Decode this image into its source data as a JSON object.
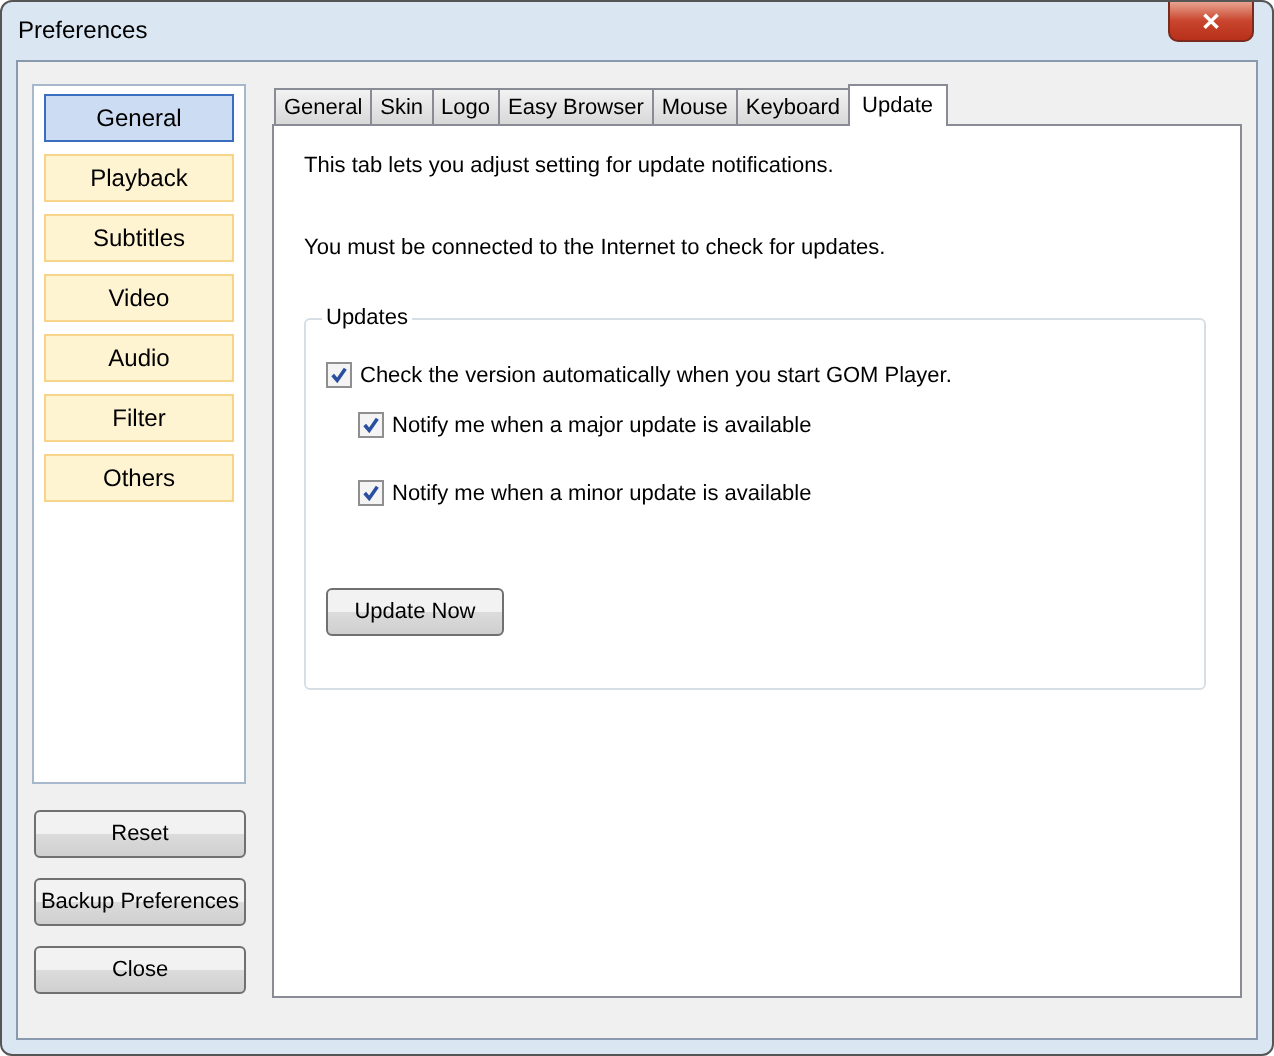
{
  "window": {
    "title": "Preferences",
    "close_label": "✕"
  },
  "sidebar": {
    "items": [
      {
        "label": "General",
        "selected": true
      },
      {
        "label": "Playback",
        "selected": false
      },
      {
        "label": "Subtitles",
        "selected": false
      },
      {
        "label": "Video",
        "selected": false
      },
      {
        "label": "Audio",
        "selected": false
      },
      {
        "label": "Filter",
        "selected": false
      },
      {
        "label": "Others",
        "selected": false
      }
    ]
  },
  "side_buttons": [
    "Reset",
    "Backup Preferences",
    "Close"
  ],
  "tabs": [
    {
      "label": "General",
      "selected": false
    },
    {
      "label": "Skin",
      "selected": false
    },
    {
      "label": "Logo",
      "selected": false
    },
    {
      "label": "Easy Browser",
      "selected": false
    },
    {
      "label": "Mouse",
      "selected": false
    },
    {
      "label": "Keyboard",
      "selected": false
    },
    {
      "label": "Update",
      "selected": true
    }
  ],
  "intro": [
    "This tab lets you adjust setting for update notifications.",
    "You must be connected to the Internet to check for updates."
  ],
  "group": {
    "title": "Updates",
    "options": [
      {
        "label": "Check the version automatically when you start GOM Player.",
        "checked": true,
        "indented": false
      },
      {
        "label": "Notify me when a major update is available",
        "checked": true,
        "indented": true
      },
      {
        "label": "Notify me when a minor update is available",
        "checked": true,
        "indented": true
      }
    ],
    "button": "Update Now"
  }
}
